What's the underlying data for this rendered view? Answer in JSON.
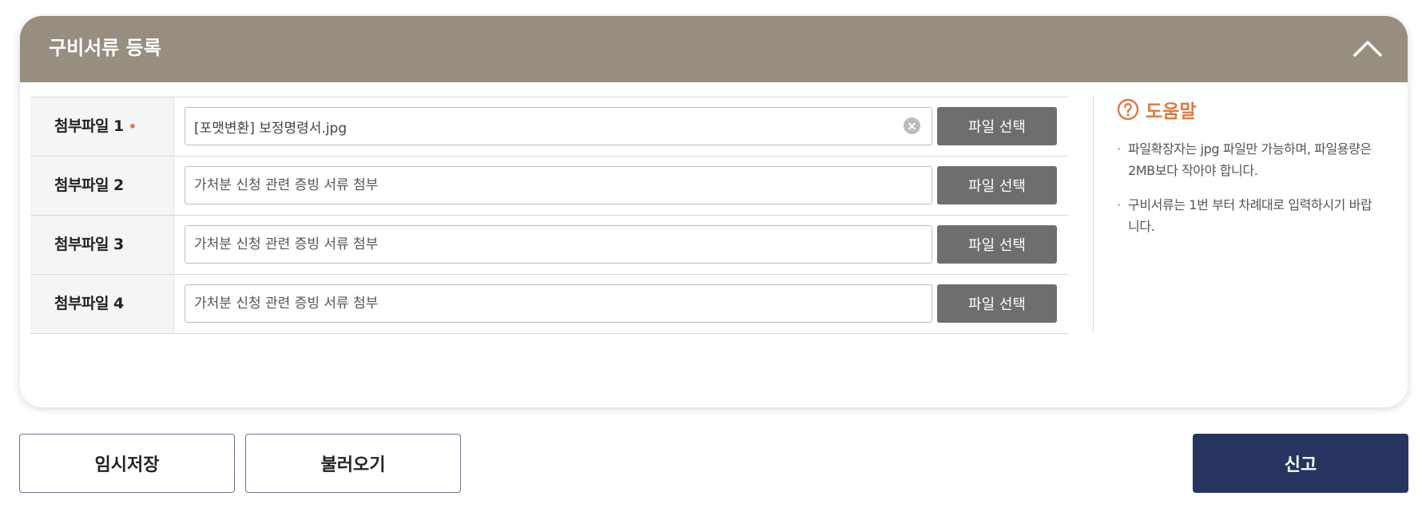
{
  "panel": {
    "title": "구비서류 등록"
  },
  "files": [
    {
      "label": "첨부파일 1",
      "required": true,
      "required_mark": "•",
      "value": "[포맷변환] 보정명령서.jpg",
      "placeholder": "가처분 신청 관련 증빙 서류 첨부",
      "has_clear": true,
      "button": "파일 선택"
    },
    {
      "label": "첨부파일 2",
      "required": false,
      "value": "",
      "placeholder": "가처분 신청 관련 증빙 서류 첨부",
      "has_clear": false,
      "button": "파일 선택"
    },
    {
      "label": "첨부파일 3",
      "required": false,
      "value": "",
      "placeholder": "가처분 신청 관련 증빙 서류 첨부",
      "has_clear": false,
      "button": "파일 선택"
    },
    {
      "label": "첨부파일 4",
      "required": false,
      "value": "",
      "placeholder": "가처분 신청 관련 증빙 서류 첨부",
      "has_clear": false,
      "button": "파일 선택"
    }
  ],
  "help": {
    "title": "도움말",
    "items": [
      "파일확장자는 jpg 파일만 가능하며, 파일용량은 2MB보다 작아야 합니다.",
      "구비서류는 1번 부터 차례대로 입력하시기 바랍니다."
    ]
  },
  "actions": {
    "temp_save": "임시저장",
    "load": "불러오기",
    "submit": "신고"
  },
  "colors": {
    "header_bg": "#978e80",
    "accent_orange": "#e07840",
    "file_button_bg": "#6e6e6e",
    "primary_button_bg": "#26345f",
    "outline_border": "#6a7493"
  },
  "icons": {
    "collapse": "chevron-up-icon",
    "clear": "clear-circle-icon",
    "help": "question-circle-icon"
  }
}
